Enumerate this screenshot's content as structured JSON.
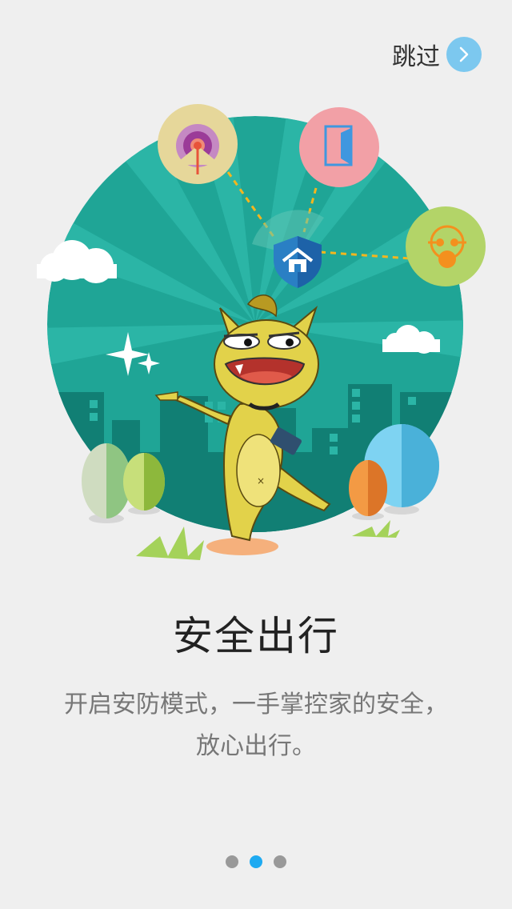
{
  "header": {
    "skip_label": "跳过",
    "skip_icon": "chevron-right-icon"
  },
  "illustration": {
    "icons": [
      "radar-icon",
      "door-icon",
      "shield-home-icon",
      "gas-mask-icon"
    ],
    "mascot": "cat-mascot",
    "colors": {
      "circle_bg": "#1fa596",
      "radar_bg": "#e6d79a",
      "door_bg": "#f2a0a6",
      "mask_bg": "#b3d468"
    }
  },
  "content": {
    "title": "安全出行",
    "description_line1": "开启安防模式，一手掌控家的安全，",
    "description_line2": "放心出行。"
  },
  "pager": {
    "total": 3,
    "active_index": 1
  },
  "colors": {
    "accent": "#1eaaf1",
    "inactive_dot": "#999999",
    "background": "#efefef"
  }
}
